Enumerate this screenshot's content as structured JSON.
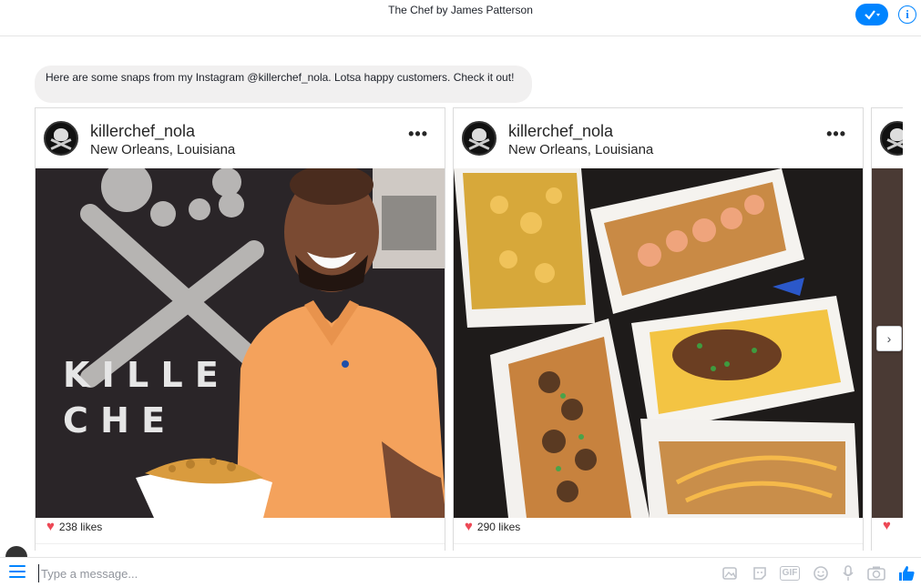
{
  "header": {
    "title": "The Chef by James Patterson"
  },
  "message": {
    "text": "Here are some snaps from my Instagram @killerchef_nola. Lotsa happy customers. Check it out!"
  },
  "cards": [
    {
      "username": "killerchef_nola",
      "location": "New Orleans, Louisiana",
      "likes": "238 likes"
    },
    {
      "username": "killerchef_nola",
      "location": "New Orleans, Louisiana",
      "likes": "290 likes"
    }
  ],
  "compose": {
    "placeholder": "Type a message..."
  },
  "colors": {
    "accent": "#0084ff",
    "heart": "#ed4956",
    "bubble": "#f1f0f0"
  },
  "icons": [
    "check-icon",
    "info-icon",
    "more-icon",
    "heart-icon",
    "chevron-right-icon",
    "menu-icon",
    "image-icon",
    "sticker-icon",
    "gif-icon",
    "emoji-icon",
    "microphone-icon",
    "camera-icon",
    "like-icon"
  ]
}
